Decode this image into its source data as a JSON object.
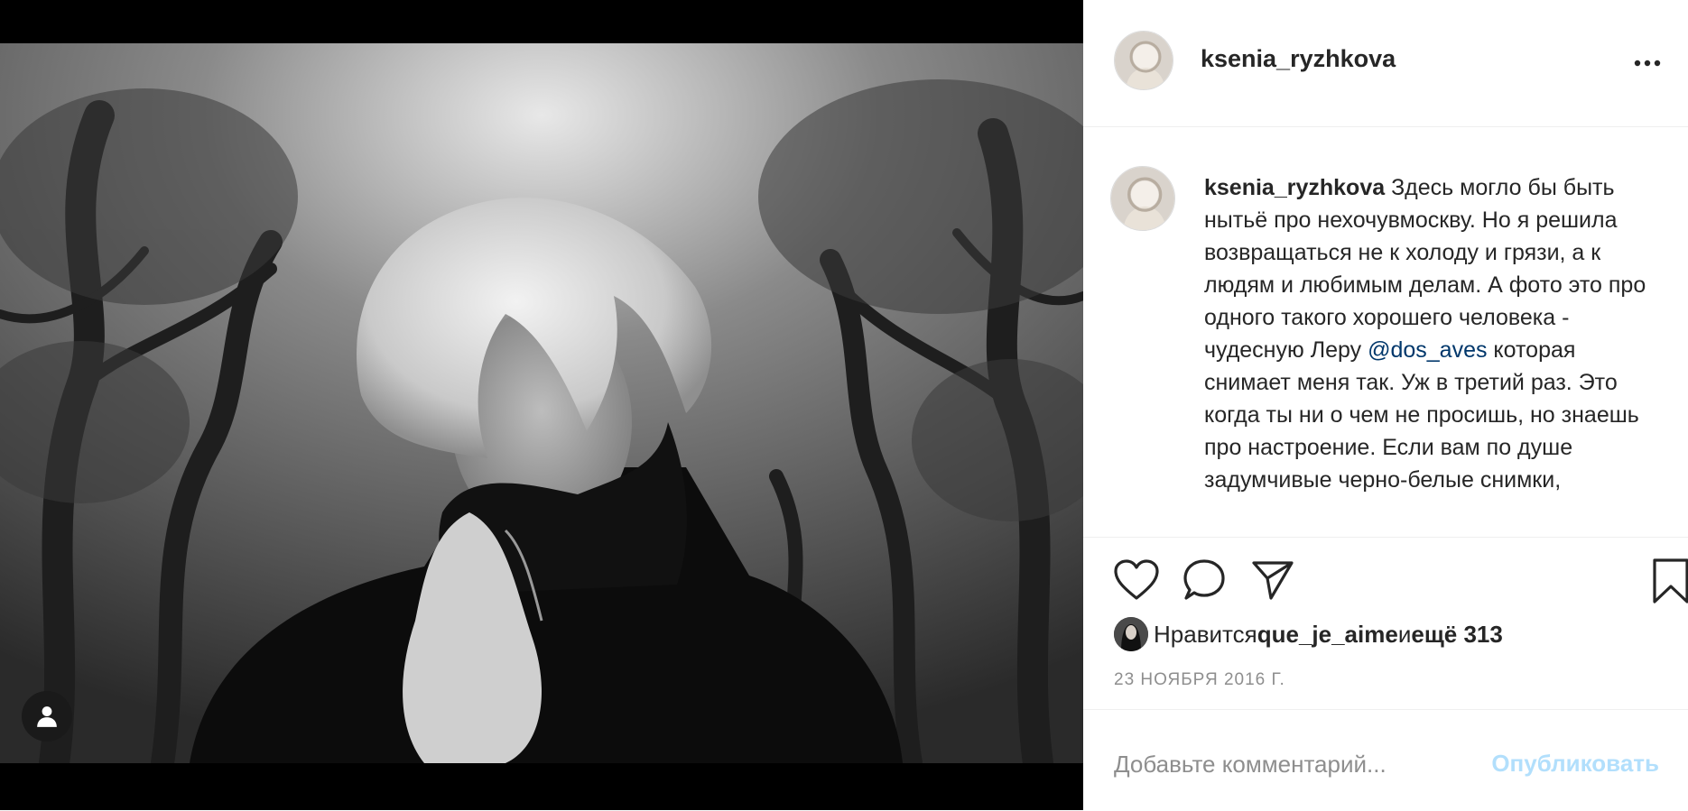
{
  "post": {
    "username": "ksenia_ryzhkova",
    "caption_before_mention": " Здесь могло бы быть нытьё про нехочувмоскву. Но я решила возвращаться не к холоду и грязи, а к людям и любимым делам. А фото это про одного такого хорошего человека - чудесную Леру ",
    "mention": "@dos_aves",
    "caption_after_mention": " которая снимает меня так. Уж в третий раз. Это когда ты ни о чем не просишь, но знаешь про настроение. Если вам по душе задумчивые черно-белые снимки,",
    "likes": {
      "prefix": "Нравится ",
      "liker": "que_je_aime",
      "connector": " и ",
      "others": "ещё 313"
    },
    "date": "23 НОЯБРЯ 2016 Г."
  },
  "comment": {
    "placeholder": "Добавьте комментарий...",
    "publish_label": "Опубликовать"
  },
  "icons": {
    "like": "heart-icon",
    "comment": "comment-icon",
    "share": "paper-plane-icon",
    "save": "bookmark-icon",
    "more": "ellipsis-icon",
    "tag": "user-tag-icon"
  },
  "colors": {
    "text": "#262626",
    "secondary": "#8e8e8e",
    "mention": "#00376b",
    "publish_disabled": "#b2dffc"
  }
}
